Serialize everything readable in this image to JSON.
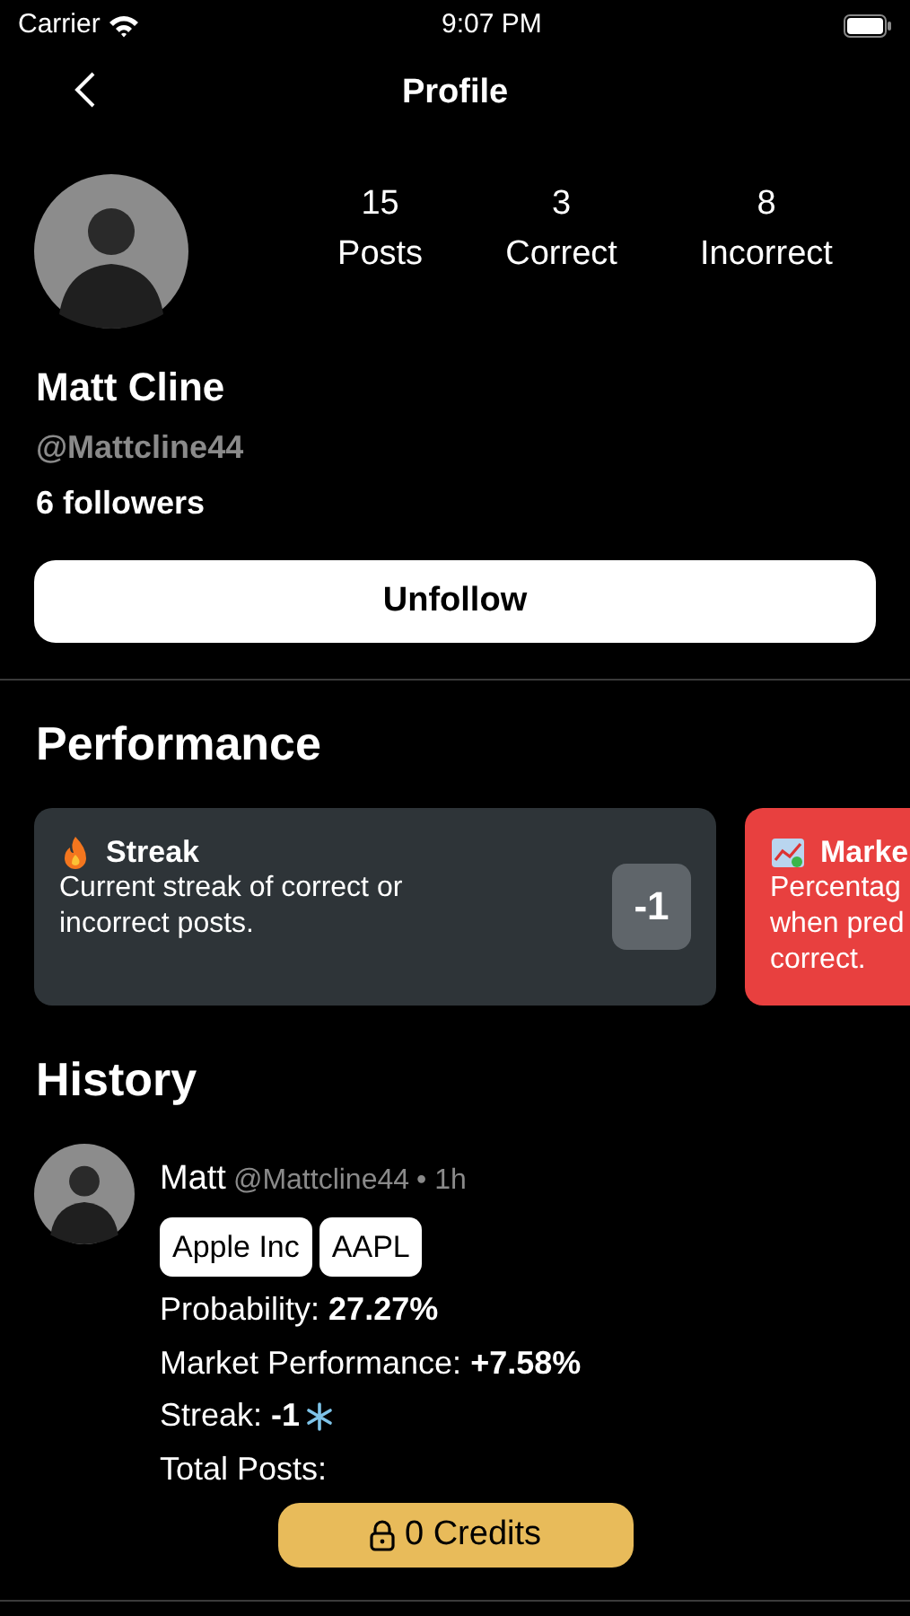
{
  "status_bar": {
    "carrier": "Carrier",
    "time": "9:07 PM"
  },
  "nav": {
    "title": "Profile"
  },
  "profile": {
    "stats": [
      {
        "value": "15",
        "label": "Posts"
      },
      {
        "value": "3",
        "label": "Correct"
      },
      {
        "value": "8",
        "label": "Incorrect"
      }
    ],
    "name": "Matt Cline",
    "handle": "@Mattcline44",
    "followers": "6 followers",
    "follow_button": "Unfollow"
  },
  "performance": {
    "title": "Performance",
    "cards": [
      {
        "kind": "streak",
        "title": "Streak",
        "description": "Current streak of correct or incorrect posts.",
        "value": "-1",
        "color": "#2e3438"
      },
      {
        "kind": "market",
        "title": "Marke",
        "description_lines": [
          "Percentag",
          "when pred",
          "correct."
        ],
        "color": "#e8403f"
      }
    ]
  },
  "history": {
    "title": "History",
    "posts": [
      {
        "author": "Matt",
        "handle": "@Mattcline44",
        "time": "• 1h",
        "tags": [
          "Apple Inc",
          "AAPL"
        ],
        "lines": [
          "Probability: **27.27%**",
          "Market Performance: **+7.58%**",
          "Streak: **-1**",
          "Total Posts:"
        ],
        "unlock_button": "0 Credits"
      }
    ]
  }
}
